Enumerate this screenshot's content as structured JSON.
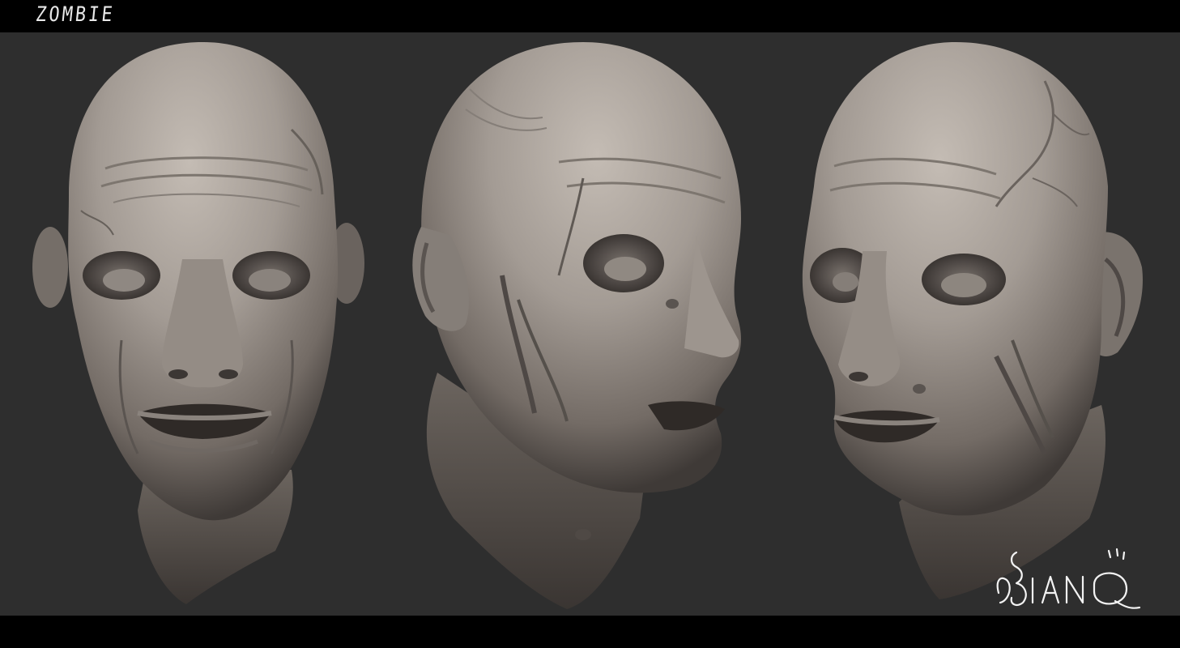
{
  "title": "ZOMBIE",
  "signature_text": "BiANQ",
  "colors": {
    "background": "#2e2e2e",
    "letterbox": "#000000",
    "clay_light": "#b4aca4",
    "clay_mid": "#8a827b",
    "clay_dark": "#3c3734",
    "title_text": "#e8e8e8"
  },
  "views": [
    "front-view",
    "three-quarter-view",
    "three-quarter-left-view"
  ]
}
